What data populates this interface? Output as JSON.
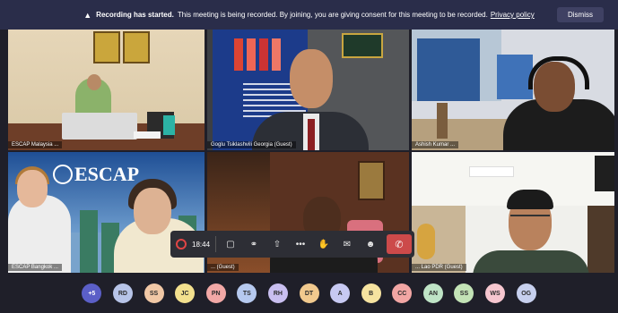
{
  "banner": {
    "warning_icon": "warning-icon",
    "bold_text": "Recording has started.",
    "text": "This meeting is being recorded. By joining, you are giving consent for this meeting to be recorded.",
    "policy_link": "Privacy policy",
    "dismiss_label": "Dismiss"
  },
  "tiles": [
    {
      "name": "ESCAP Malaysia ...",
      "background": "#e6d6b8"
    },
    {
      "name": "Goglu Tsiklashvili Georgia (Guest)",
      "background": "#3c3f44"
    },
    {
      "name": "Ashish Kumar ...",
      "background": "#d8dbe2"
    },
    {
      "name": "ESCAP Bangkok ...",
      "background": "#78a3cc",
      "logo": "ESCAP"
    },
    {
      "name": "... (Guest)",
      "background": "#5a3221"
    },
    {
      "name": "... Lao PDR (Guest)",
      "background": "#f0f0ec"
    }
  ],
  "controls": {
    "timer": "18:44",
    "icons": [
      "video-icon",
      "mic-icon",
      "share-icon",
      "more-icon",
      "raise-hand-icon",
      "chat-icon",
      "participants-icon",
      "hangup-icon"
    ],
    "accent": "#cc4a4a"
  },
  "participants": [
    {
      "initials": "+5",
      "color": "#5b5fc7",
      "text": "#ffffff"
    },
    {
      "initials": "RD",
      "color": "#b7c4e8",
      "text": "#2a2a2a"
    },
    {
      "initials": "SS",
      "color": "#f1c8a6",
      "text": "#2a2a2a"
    },
    {
      "initials": "JC",
      "color": "#f3e08e",
      "text": "#2a2a2a"
    },
    {
      "initials": "PN",
      "color": "#f2a8a6",
      "text": "#2a2a2a"
    },
    {
      "initials": "TS",
      "color": "#b6c9ef",
      "text": "#2a2a2a"
    },
    {
      "initials": "RH",
      "color": "#c9bff0",
      "text": "#2a2a2a"
    },
    {
      "initials": "DT",
      "color": "#f1c98e",
      "text": "#2a2a2a"
    },
    {
      "initials": "A",
      "color": "#c7c9f2",
      "text": "#2a2a2a"
    },
    {
      "initials": "B",
      "color": "#f6e3a0",
      "text": "#2a2a2a"
    },
    {
      "initials": "CC",
      "color": "#f2a6a4",
      "text": "#2a2a2a"
    },
    {
      "initials": "AN",
      "color": "#bfe4c6",
      "text": "#2a2a2a"
    },
    {
      "initials": "SS",
      "color": "#c3e3b6",
      "text": "#2a2a2a"
    },
    {
      "initials": "WS",
      "color": "#f6c6cf",
      "text": "#2a2a2a"
    },
    {
      "initials": "OG",
      "color": "#c7d0ee",
      "text": "#2a2a2a"
    }
  ]
}
